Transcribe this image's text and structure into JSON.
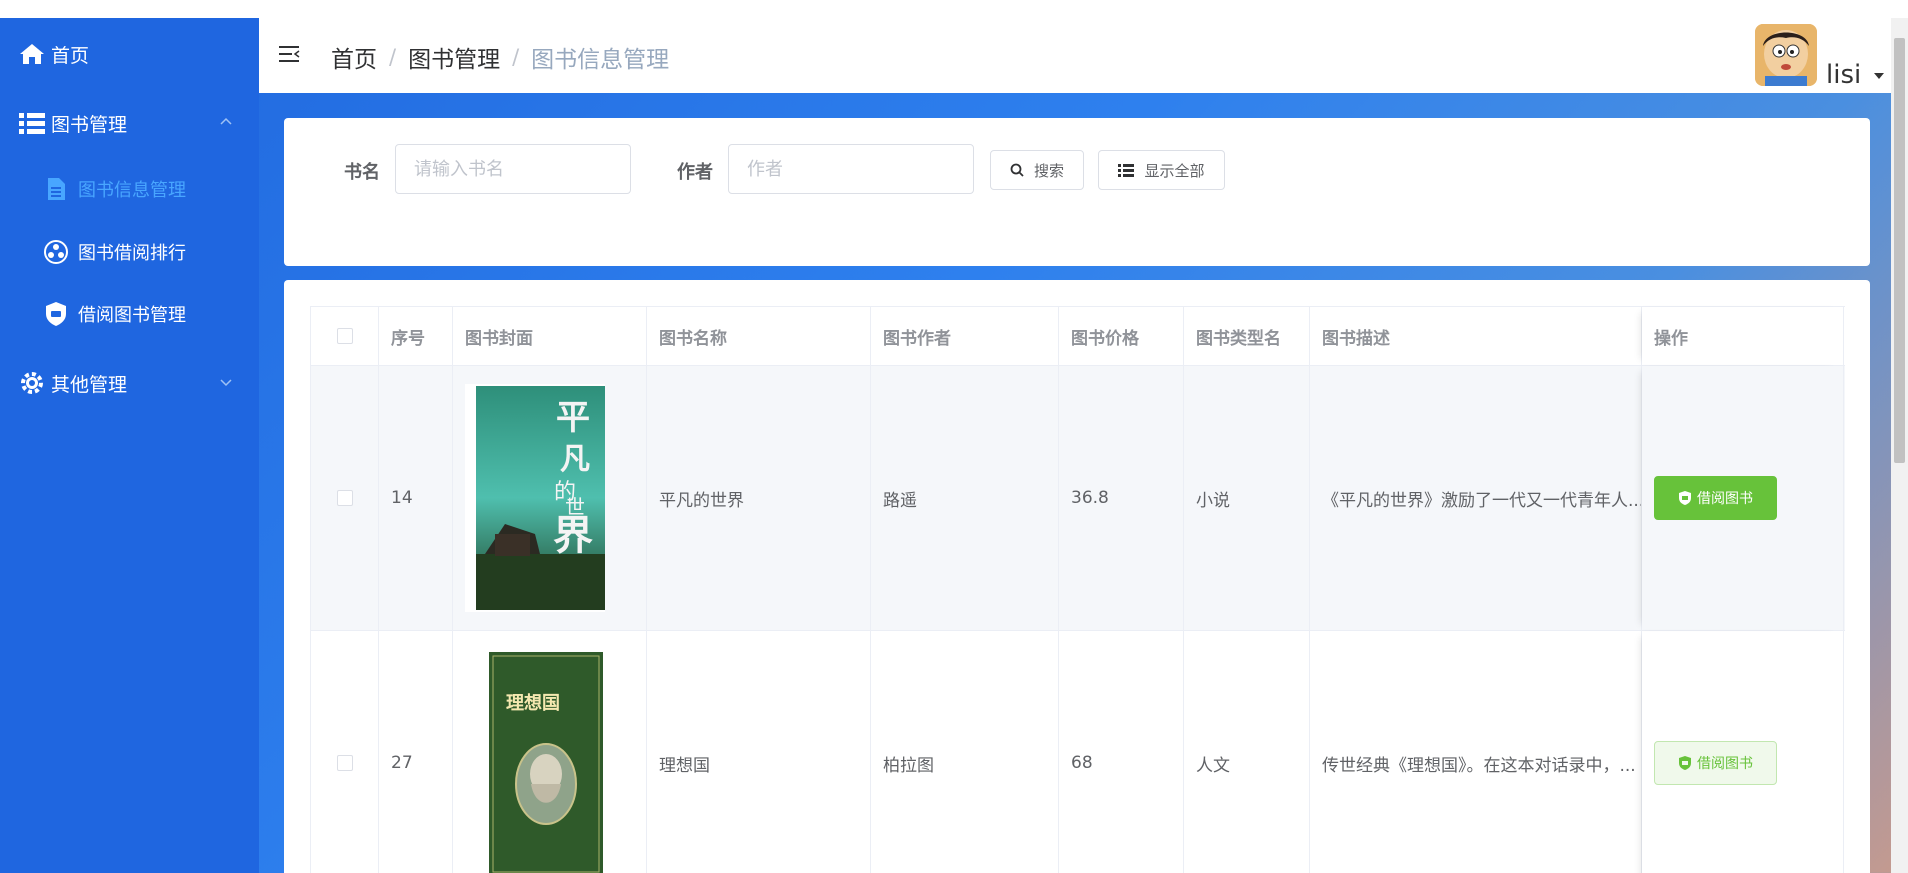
{
  "sidebar": {
    "items": [
      {
        "label": "首页",
        "icon": "home-icon"
      },
      {
        "label": "图书管理",
        "icon": "list-icon",
        "expanded": true,
        "children": [
          {
            "label": "图书信息管理",
            "icon": "document-icon",
            "active": true
          },
          {
            "label": "图书借阅排行",
            "icon": "ranking-icon"
          },
          {
            "label": "借阅图书管理",
            "icon": "shield-icon"
          }
        ]
      },
      {
        "label": "其他管理",
        "icon": "gear-icon",
        "expanded": false
      }
    ]
  },
  "header": {
    "breadcrumb": [
      "首页",
      "图书管理",
      "图书信息管理"
    ],
    "username": "lisi"
  },
  "search": {
    "name_label": "书名",
    "name_placeholder": "请输入书名",
    "author_label": "作者",
    "author_placeholder": "作者",
    "search_button": "搜索",
    "show_all_button": "显示全部"
  },
  "table": {
    "columns": [
      "序号",
      "图书封面",
      "图书名称",
      "图书作者",
      "图书价格",
      "图书类型名",
      "图书描述",
      "操作"
    ],
    "rows": [
      {
        "id": "14",
        "name": "平凡的世界",
        "author": "路遥",
        "price": "36.8",
        "type": "小说",
        "description": "《平凡的世界》激励了一代又一代青年人...",
        "action": "借阅图书",
        "cover_title": "平凡的世界"
      },
      {
        "id": "27",
        "name": "理想国",
        "author": "柏拉图",
        "price": "68",
        "type": "人文",
        "description": "传世经典《理想国》。在这本对话录中，...",
        "action": "借阅图书",
        "cover_title": "理想国"
      }
    ]
  },
  "colors": {
    "sidebar_bg": "#1f66e0",
    "active_menu": "#48a6ff",
    "success": "#67c23a"
  }
}
